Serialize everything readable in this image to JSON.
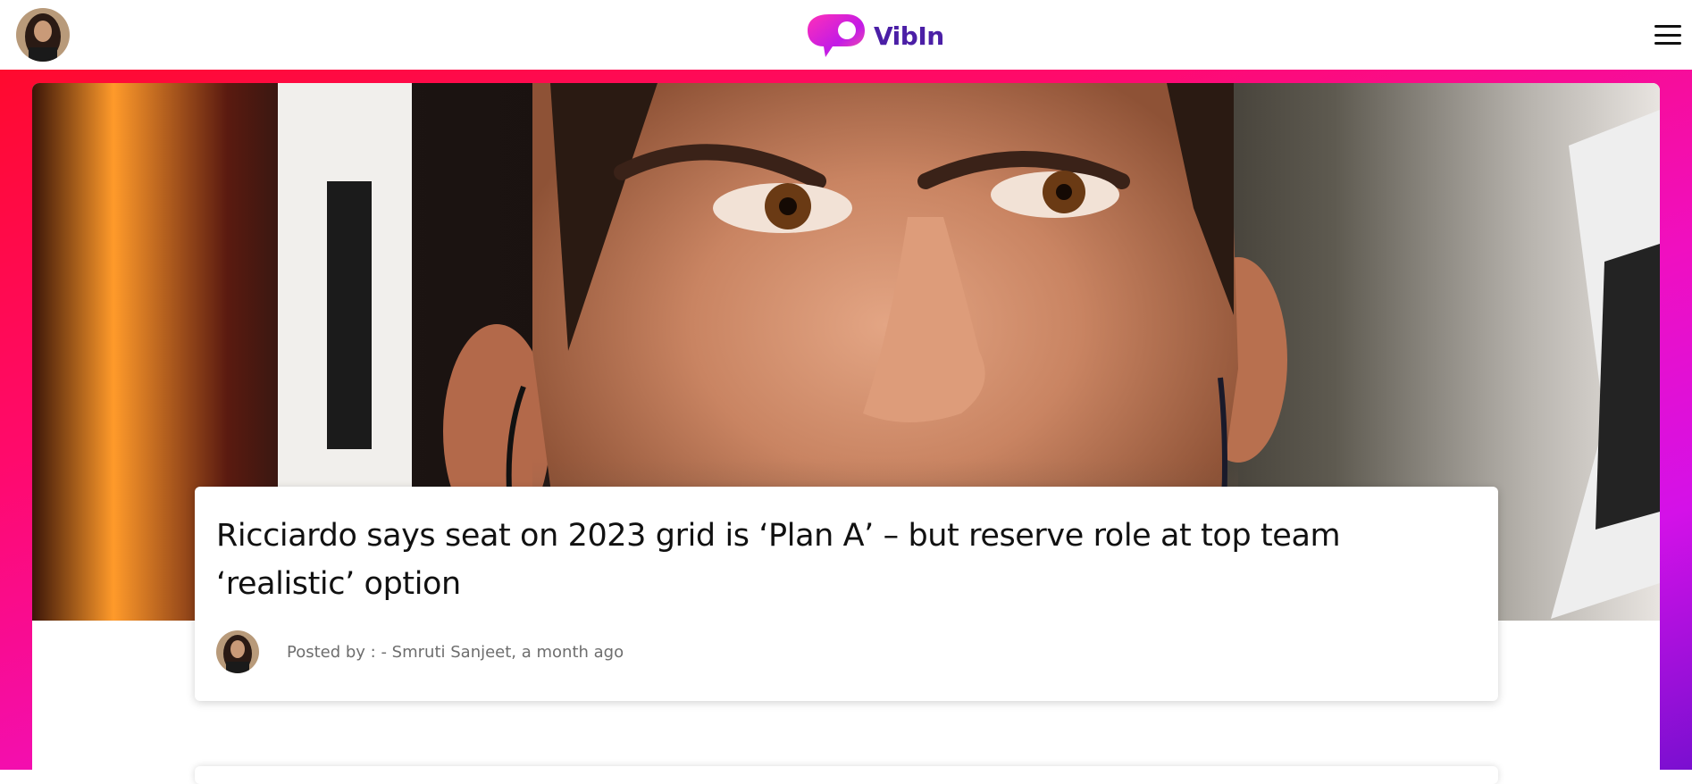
{
  "header": {
    "brand_name": "VibIn",
    "user_avatar_icon": "user-avatar",
    "menu_icon": "hamburger-menu-icon"
  },
  "colors": {
    "brand_purple": "#4b1fa6",
    "frame_gradient_start": "#ff0a2e",
    "frame_gradient_mid": "#f00fc0",
    "frame_gradient_end": "#7a0fd0"
  },
  "article": {
    "hero_image": "close-up portrait of race driver",
    "title": "Ricciardo says seat on 2023 grid is ‘Plan A’ – but reserve role at top team ‘realistic’ option",
    "posted_by": "Posted by : - Smruti Sanjeet, a month ago"
  }
}
